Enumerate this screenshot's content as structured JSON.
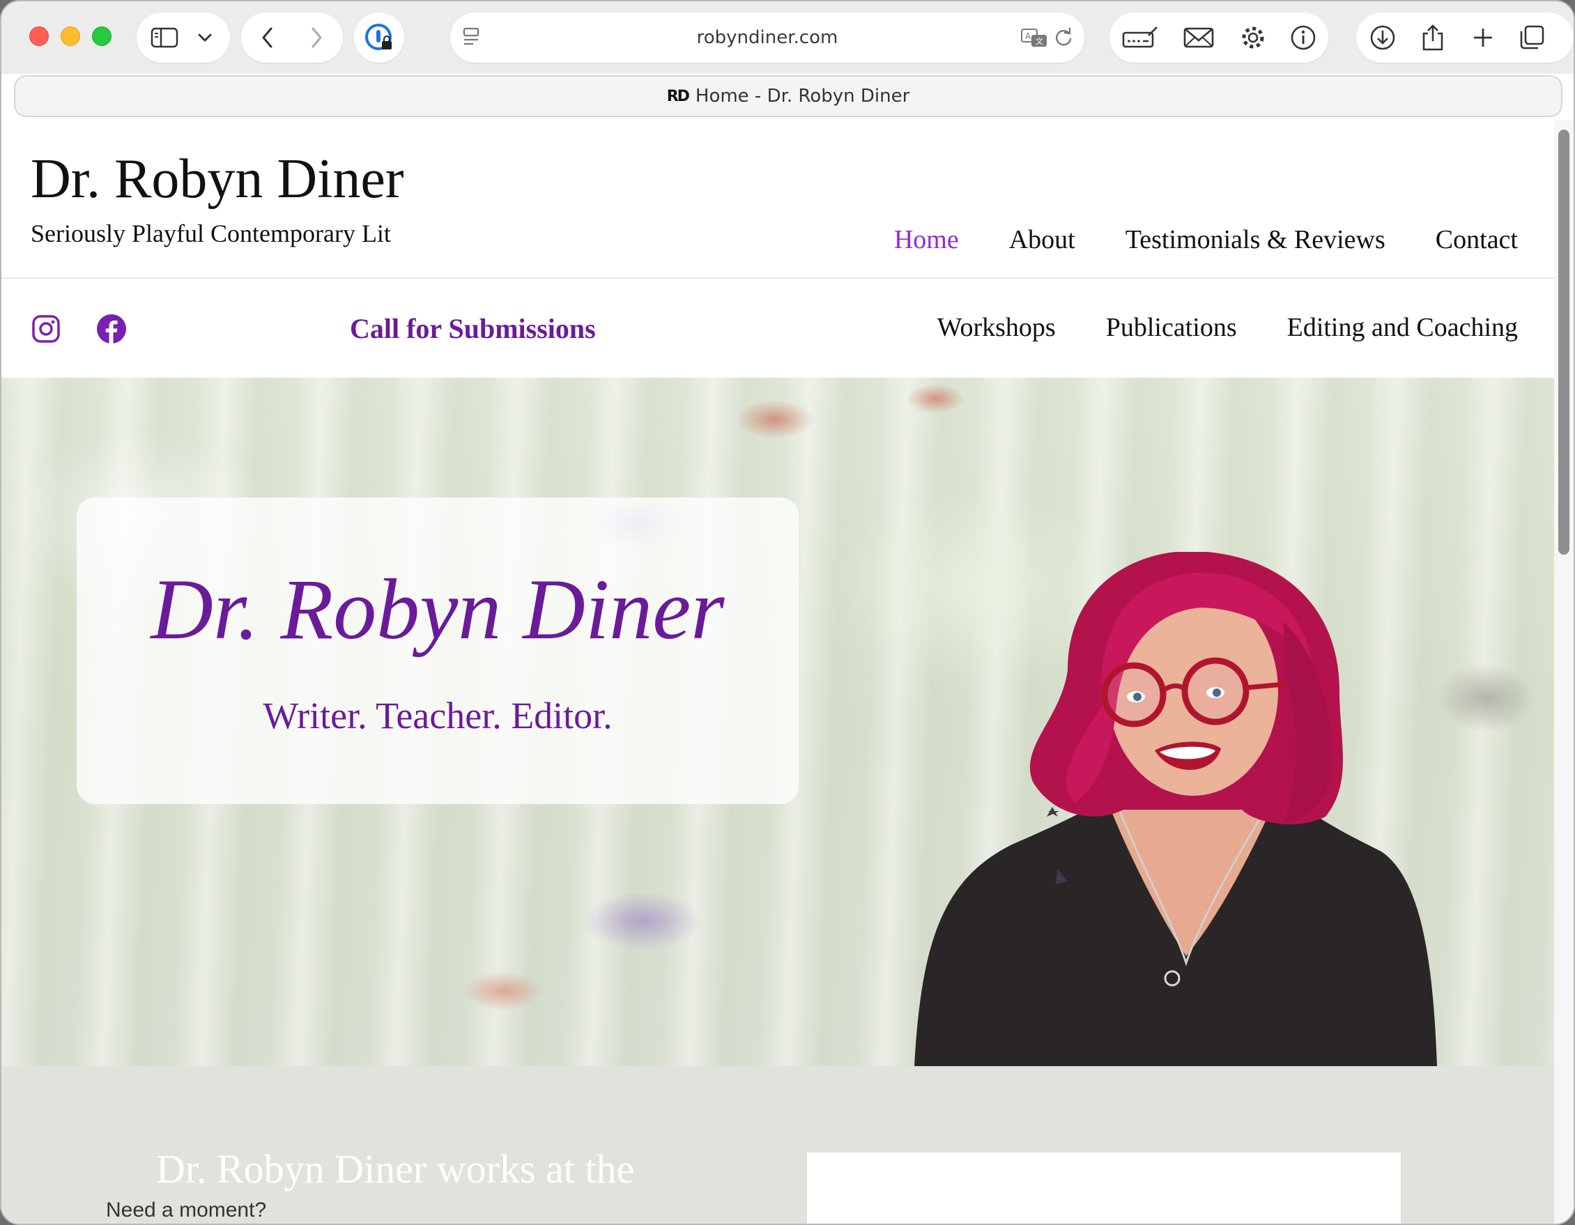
{
  "browser": {
    "url": "robyndiner.com",
    "tab_title": "Home - Dr. Robyn Diner",
    "tab_favicon": "RD"
  },
  "site": {
    "title": "Dr. Robyn Diner",
    "tagline": "Seriously Playful Contemporary Lit",
    "accent_color": "#8a2be2",
    "brand_purple": "#6a1b9a"
  },
  "main_nav": [
    {
      "label": "Home",
      "active": true
    },
    {
      "label": "About",
      "active": false
    },
    {
      "label": "Testimonials & Reviews",
      "active": false
    },
    {
      "label": "Contact",
      "active": false
    }
  ],
  "sub_header": {
    "social": [
      "instagram-icon",
      "facebook-icon"
    ],
    "call_for_submissions": "Call for Submissions",
    "nav": [
      "Workshops",
      "Publications",
      "Editing and Coaching"
    ]
  },
  "hero": {
    "title": "Dr. Robyn Diner",
    "subtitle": "Writer. Teacher. Editor."
  },
  "intro": {
    "text": "Dr. Robyn Diner works at the",
    "peek_text": "Need a moment?"
  }
}
